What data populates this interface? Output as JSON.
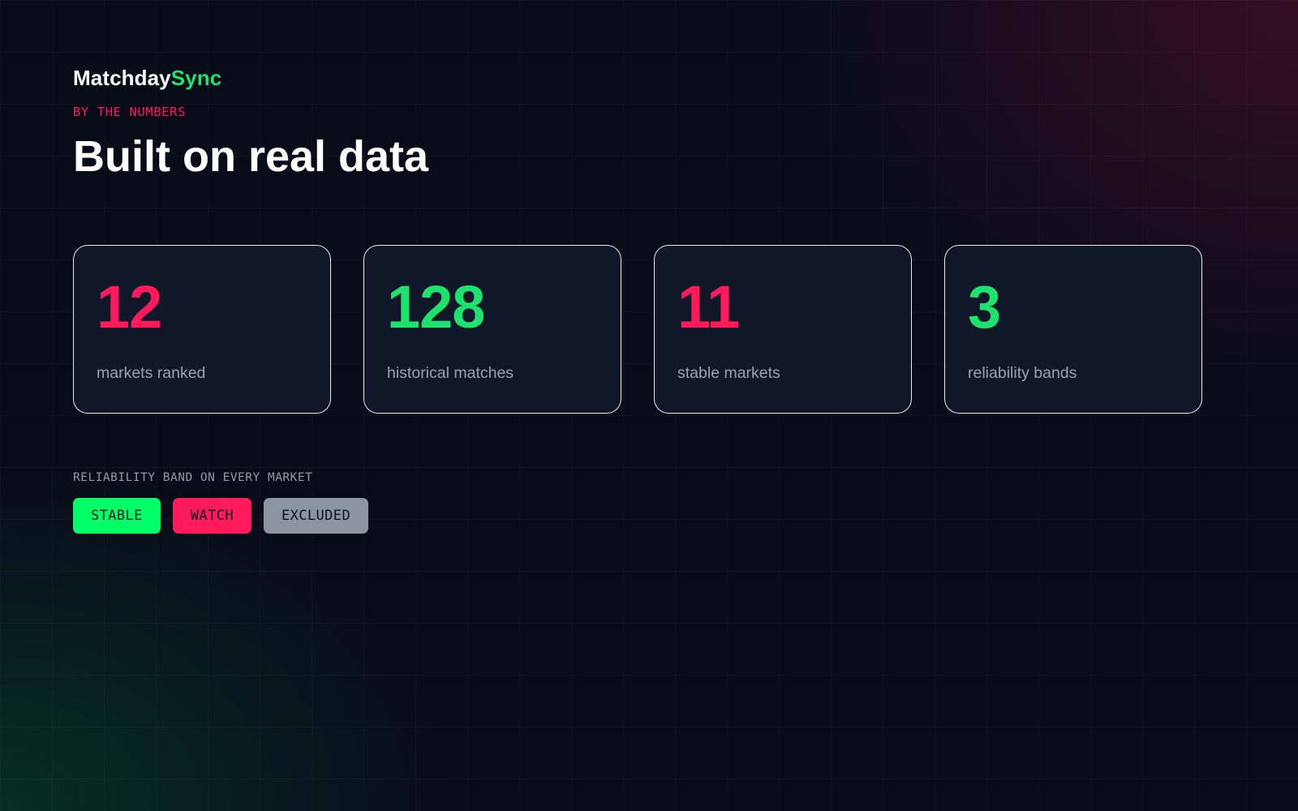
{
  "brand": {
    "part1": "Matchday",
    "part2": "Sync"
  },
  "hero": {
    "eyebrow": "BY THE NUMBERS",
    "headline": "Built on real data"
  },
  "stats": [
    {
      "value": "12",
      "label": "markets ranked",
      "color": "#ff1a5c"
    },
    {
      "value": "128",
      "label": "historical matches",
      "color": "#1de26d"
    },
    {
      "value": "11",
      "label": "stable markets",
      "color": "#ff1a5c"
    },
    {
      "value": "3",
      "label": "reliability bands",
      "color": "#1de26d"
    }
  ],
  "bands": {
    "title": "RELIABILITY BAND ON EVERY MARKET",
    "items": [
      {
        "label": "STABLE",
        "color": "#00ff66"
      },
      {
        "label": "WATCH",
        "color": "#ff1a5c"
      },
      {
        "label": "EXCLUDED",
        "color": "#8c949f"
      }
    ]
  }
}
